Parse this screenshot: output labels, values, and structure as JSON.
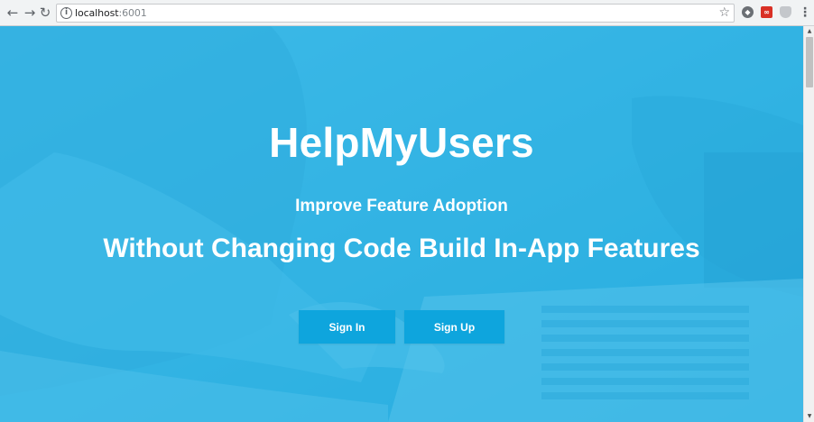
{
  "browser": {
    "url_host": "localhost",
    "url_port": ":6001",
    "back_icon": "arrow-left-icon",
    "forward_icon": "arrow-right-icon",
    "reload_icon": "reload-icon",
    "info_icon": "info-icon",
    "bookmark_icon": "star-icon",
    "menu_icon": "kebab-menu-icon"
  },
  "hero": {
    "title": "HelpMyUsers",
    "subtitle": "Improve Feature Adoption",
    "tagline": "Without Changing Code Build In-App Features",
    "accent_color": "#2db4e6",
    "button_color": "#0ea5dd"
  },
  "actions": {
    "sign_in_label": "Sign In",
    "sign_up_label": "Sign Up"
  }
}
